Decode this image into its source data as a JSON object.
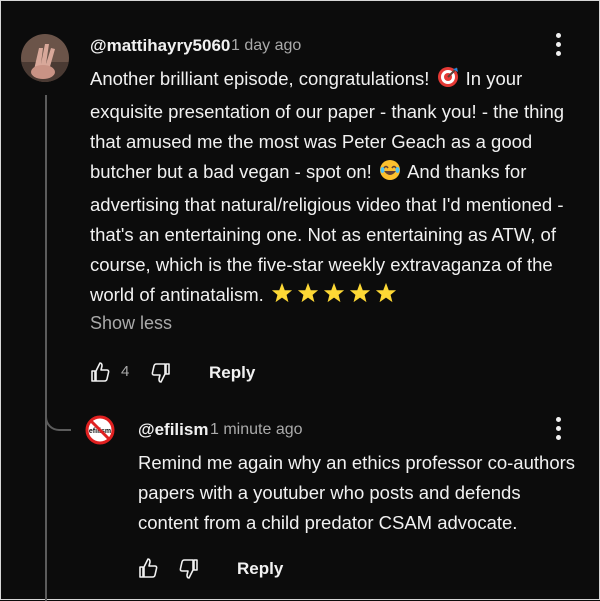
{
  "comment": {
    "author": "@mattihayry5060",
    "time": "1 day ago",
    "lines": [
      "Another brilliant episode, congratulations!",
      "exquisite presentation of our paper - thank you! - the thing",
      "that amused me the most was Peter Geach as a good",
      "butcher but a bad vegan - spot on!",
      "advertising that natural/religious video that I'd mentioned -",
      "that's an entertaining one. Not as entertaining as ATW, of",
      "course, which is the five-star weekly extravaganza of the",
      "world of antinatalism."
    ],
    "line1_tail": "In your",
    "line4_tail": "And thanks for",
    "show_less": "Show less",
    "like_count": "4",
    "reply_label": "Reply",
    "icons": [
      "direct-hit-emoji",
      "laughing-emoji",
      "star-emoji",
      "thumb-up-icon",
      "thumb-down-icon",
      "more-vert-icon"
    ]
  },
  "reply": {
    "author": "@efilism",
    "time": "1 minute ago",
    "avatar_text": "efilism",
    "lines": [
      "Remind me again why an ethics professor co-authors",
      "papers with a youtuber who posts and defends",
      "content from a child predator CSAM advocate."
    ],
    "reply_label": "Reply"
  },
  "colors": {
    "background": "#0c0c0c",
    "text": "#f1f1f1",
    "secondary": "#aaaaaa",
    "accent_red": "#e02020"
  }
}
